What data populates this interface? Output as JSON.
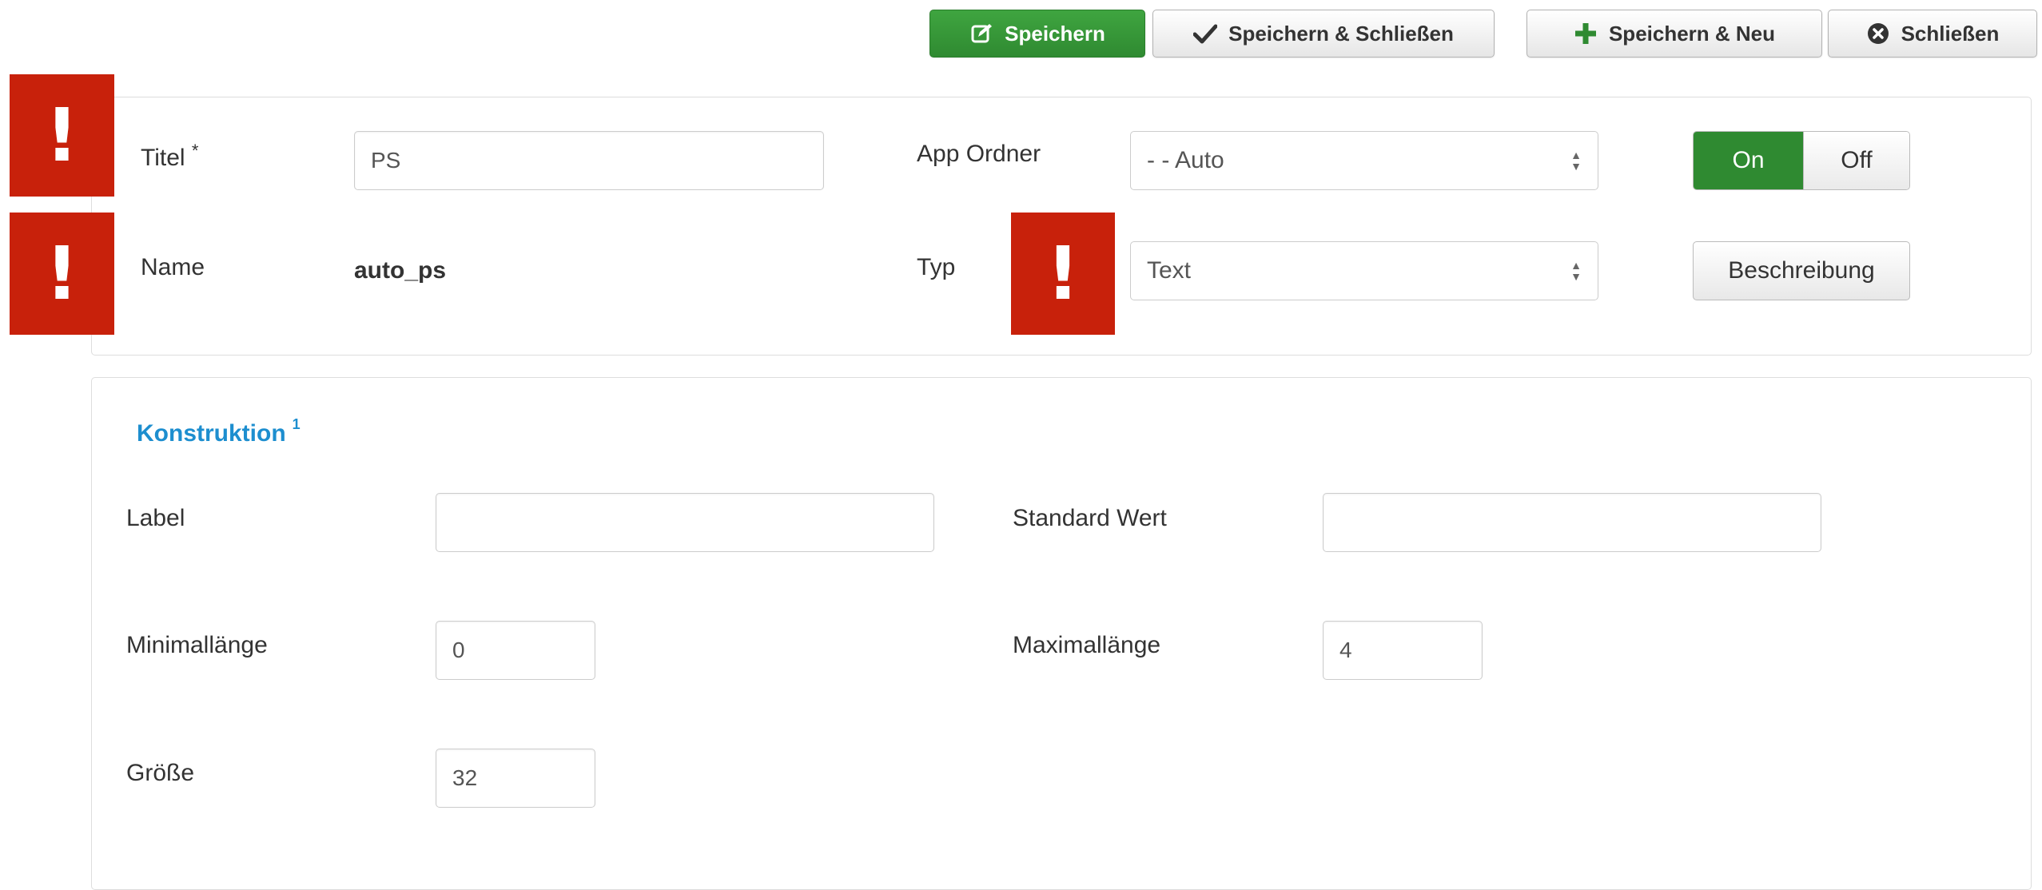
{
  "toolbar": {
    "save": {
      "label": "Speichern",
      "icon": "edit-icon"
    },
    "save_close": {
      "label": "Speichern & Schließen",
      "icon": "check-icon"
    },
    "save_new": {
      "label": "Speichern & Neu",
      "icon": "plus-icon"
    },
    "close": {
      "label": "Schließen",
      "icon": "close-circle-icon"
    }
  },
  "top_panel": {
    "title_label": "Titel",
    "title_required": "*",
    "title_value": "PS",
    "app_folder_label": "App Ordner",
    "app_folder_value": "- - Auto",
    "toggle_on": "On",
    "toggle_off": "Off",
    "name_label": "Name",
    "name_value": "auto_ps",
    "type_label": "Typ",
    "type_value": "Text",
    "description_button": "Beschreibung"
  },
  "construction": {
    "title": "Konstruktion",
    "sup": "1",
    "label_label": "Label",
    "label_value": "",
    "default_label": "Standard Wert",
    "default_value": "",
    "min_label": "Minimallänge",
    "min_value": "0",
    "max_label": "Maximallänge",
    "max_value": "4",
    "size_label": "Größe",
    "size_value": "32"
  },
  "warnings": {
    "symbol": "!"
  },
  "colors": {
    "primary_green": "#2f8a31",
    "warning_red": "#c8210b",
    "section_blue": "#1d8ecf"
  }
}
